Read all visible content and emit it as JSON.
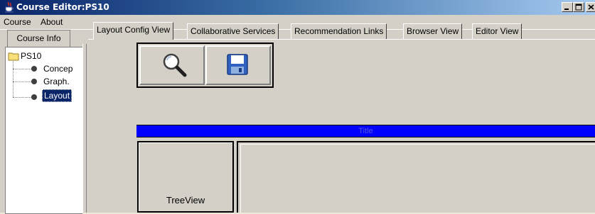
{
  "window": {
    "title": "Course Editor:PS10",
    "icon": "java-cup-icon"
  },
  "window_controls": {
    "minimize": "_",
    "maximize": "□",
    "close": "×"
  },
  "menu": {
    "items": [
      "Course",
      "About"
    ]
  },
  "left_tab": {
    "label": "Course Info"
  },
  "tree": {
    "root": "PS10",
    "children": [
      "Concep",
      "Graph.",
      "Layout"
    ],
    "selected_index": 2
  },
  "tabs": [
    {
      "label": "Layout Config View",
      "active": true
    },
    {
      "label": "Collaborative Services",
      "active": false
    },
    {
      "label": "Recommendation Links",
      "active": false
    },
    {
      "label": "Browser View",
      "active": false
    },
    {
      "label": "Editor View",
      "active": false
    }
  ],
  "toolbar": {
    "search_icon": "magnifier-icon",
    "save_icon": "floppy-disk-icon"
  },
  "layout": {
    "title_band": "Title",
    "title_band_color": "#0000ff",
    "treeview_label": "TreeView"
  }
}
